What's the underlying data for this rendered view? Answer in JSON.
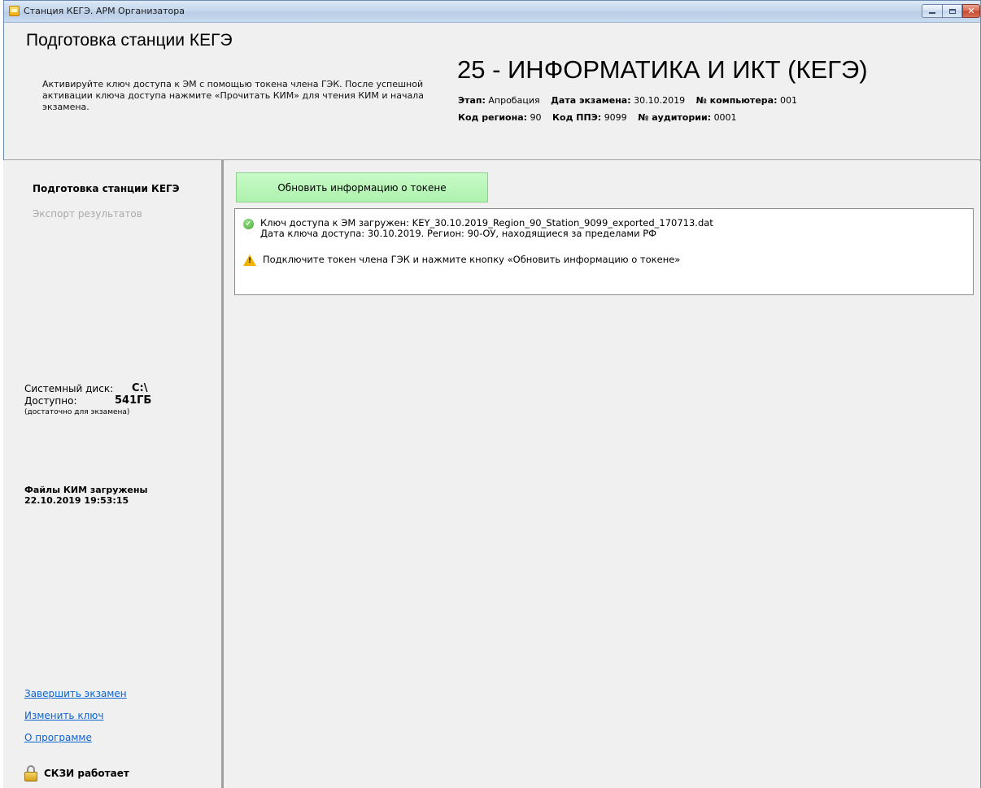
{
  "window": {
    "title": "Станция КЕГЭ. АРМ Организатора",
    "close_glyph": "✕"
  },
  "header": {
    "stage_title": "Подготовка станции КЕГЭ",
    "stage_description": "Активируйте ключ доступа к ЭМ с помощью токена члена ГЭК. После успешной активации ключа доступа нажмите «Прочитать КИМ» для чтения КИМ и начала экзамена.",
    "subject_title": "25 - ИНФОРМАТИКА И ИКТ (КЕГЭ)",
    "info": {
      "stage_label": "Этап:",
      "stage_value": "Апробация",
      "exam_date_label": "Дата экзамена:",
      "exam_date_value": "30.10.2019",
      "computer_label": "№ компьютера:",
      "computer_value": "001",
      "region_label": "Код региона:",
      "region_value": "90",
      "ppe_label": "Код ППЭ:",
      "ppe_value": "9099",
      "room_label": "№ аудитории:",
      "room_value": "0001"
    }
  },
  "sidebar": {
    "nav_active": "Подготовка станции КЕГЭ",
    "nav_disabled": "Экспорт результатов",
    "disk": {
      "label": "Системный диск:",
      "value": "C:\\",
      "available_label": "Доступно:",
      "available_value": "541ГБ",
      "note": "(достаточно для экзамена)"
    },
    "kim_status_line1": "Файлы КИМ загружены",
    "kim_status_line2": "22.10.2019 19:53:15",
    "links": {
      "finish_exam": "Завершить экзамен",
      "change_key": "Изменить ключ",
      "about": "О программе"
    },
    "skzi_status": "СКЗИ работает"
  },
  "main": {
    "refresh_button": "Обновить информацию о токене",
    "status": {
      "ok_line1": "Ключ доступа к ЭМ загружен: KEY_30.10.2019_Region_90_Station_9099_exported_170713.dat",
      "ok_line2": "Дата ключа доступа: 30.10.2019. Регион: 90-ОУ, находящиеся за пределами РФ",
      "warning": "Подключите токен члена ГЭК и нажмите кнопку «Обновить информацию о токене»"
    }
  },
  "icons": {
    "app": "app-icon",
    "ok": "check-circle-icon",
    "warning": "warning-triangle-icon",
    "lock": "padlock-icon"
  },
  "colors": {
    "refresh_button_bg": "#b8f5b8",
    "link": "#0a64d6",
    "disabled_text": "#a9a9a9",
    "ok_icon": "#3fa831",
    "warning_icon": "#f2b200"
  }
}
